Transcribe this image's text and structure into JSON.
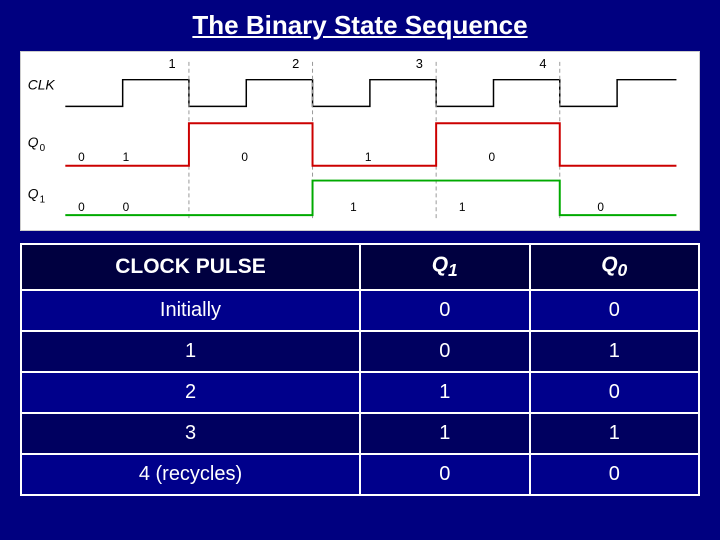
{
  "title": "The Binary State Sequence",
  "timing": {
    "clk_label": "CLK",
    "q0_label": "Q",
    "q0_sub": "0",
    "q1_label": "Q",
    "q1_sub": "1",
    "pulse_numbers": [
      "1",
      "2",
      "3",
      "4"
    ],
    "q0_annotations": [
      "0",
      "1",
      "0",
      "1",
      "0"
    ],
    "q1_annotations": [
      "0",
      "0",
      "1",
      "1",
      "0"
    ]
  },
  "table": {
    "headers": [
      "CLOCK PULSE",
      "Q₁",
      "Q₀"
    ],
    "rows": [
      {
        "pulse": "Initially",
        "q1": "0",
        "q0": "0"
      },
      {
        "pulse": "1",
        "q1": "0",
        "q0": "1"
      },
      {
        "pulse": "2",
        "q1": "1",
        "q0": "0"
      },
      {
        "pulse": "3",
        "q1": "1",
        "q0": "1"
      },
      {
        "pulse": "4 (recycles)",
        "q1": "0",
        "q0": "0"
      }
    ]
  }
}
